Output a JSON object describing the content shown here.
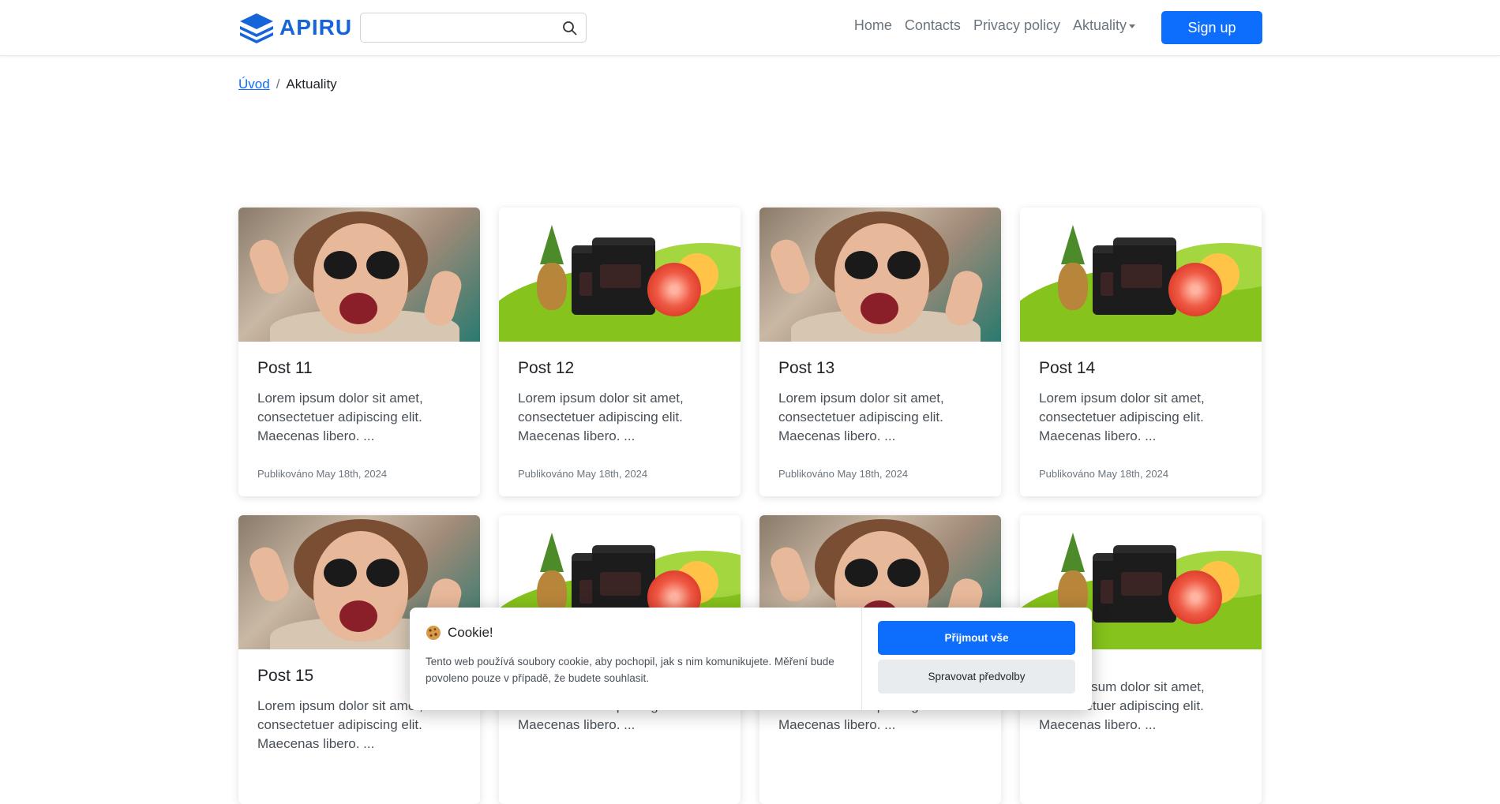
{
  "header": {
    "brand": "APIRU",
    "search": {
      "value": "",
      "placeholder": ""
    },
    "nav": [
      {
        "label": "Home"
      },
      {
        "label": "Contacts"
      },
      {
        "label": "Privacy policy"
      },
      {
        "label": "Aktuality"
      }
    ],
    "signup_label": "Sign up",
    "colors": {
      "accent": "#0d6efd",
      "brand": "#1565d8"
    }
  },
  "breadcrumb": {
    "home": "Úvod",
    "separator": "/",
    "current": "Aktuality"
  },
  "posts": [
    {
      "title": "Post 11",
      "excerpt": "Lorem ipsum dolor sit amet, consectetuer adipiscing elit. Maecenas libero. ...",
      "meta": "Publikováno May 18th, 2024",
      "image": "woman-photo"
    },
    {
      "title": "Post 12",
      "excerpt": "Lorem ipsum dolor sit amet, consectetuer adipiscing elit. Maecenas libero. ...",
      "meta": "Publikováno May 18th, 2024",
      "image": "product-photo"
    },
    {
      "title": "Post 13",
      "excerpt": "Lorem ipsum dolor sit amet, consectetuer adipiscing elit. Maecenas libero. ...",
      "meta": "Publikováno May 18th, 2024",
      "image": "woman-photo"
    },
    {
      "title": "Post 14",
      "excerpt": "Lorem ipsum dolor sit amet, consectetuer adipiscing elit. Maecenas libero. ...",
      "meta": "Publikováno May 18th, 2024",
      "image": "product-photo"
    },
    {
      "title": "Post 15",
      "excerpt": "Lorem ipsum dolor sit amet, consectetuer adipiscing elit. Maecenas libero. ...",
      "meta": "",
      "image": "woman-photo"
    },
    {
      "title": "",
      "excerpt": "Lorem ipsum dolor sit amet, consectetuer adipiscing elit. Maecenas libero. ...",
      "meta": "",
      "image": "product-photo"
    },
    {
      "title": "",
      "excerpt": "Lorem ipsum dolor sit amet, consectetuer adipiscing elit. Maecenas libero. ...",
      "meta": "",
      "image": "woman-photo"
    },
    {
      "title": "",
      "excerpt": "Lorem ipsum dolor sit amet, consectetuer adipiscing elit. Maecenas libero. ...",
      "meta": "",
      "image": "product-photo"
    }
  ],
  "cookie": {
    "icon": "cookie-icon",
    "title": "Cookie!",
    "text": "Tento web používá soubory cookie, aby pochopil, jak s nim komunikujete. Měření bude povoleno pouze v případě, že budete souhlasit.",
    "accept_label": "Přijmout vše",
    "manage_label": "Spravovat předvolby"
  }
}
